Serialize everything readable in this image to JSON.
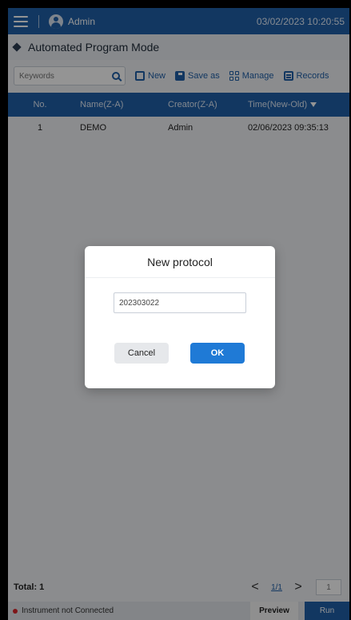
{
  "header": {
    "user": "Admin",
    "datetime": "03/02/2023 10:20:55"
  },
  "mode_title": "Automated Program Mode",
  "toolbar": {
    "search_placeholder": "Keywords",
    "new_label": "New",
    "save_as_label": "Save as",
    "manage_label": "Manage",
    "records_label": "Records"
  },
  "table": {
    "columns": [
      "No.",
      "Name(Z-A)",
      "Creator(Z-A)",
      "Time(New-Old)"
    ],
    "rows": [
      [
        "1",
        "DEMO",
        "Admin",
        "02/06/2023 09:35:13"
      ]
    ]
  },
  "footer": {
    "total": "Total: 1",
    "page": "1/1",
    "page_input_placeholder": "1"
  },
  "status": {
    "text": "Instrument not Connected",
    "preview_label": "Preview",
    "run_label": "Run"
  },
  "dialog": {
    "title": "New protocol",
    "input_value": "202303022",
    "cancel_label": "Cancel",
    "ok_label": "OK"
  },
  "colors": {
    "header_blue": "#1f5fa8",
    "ok_blue": "#1f7ad6",
    "status_red": "#d9262c"
  }
}
